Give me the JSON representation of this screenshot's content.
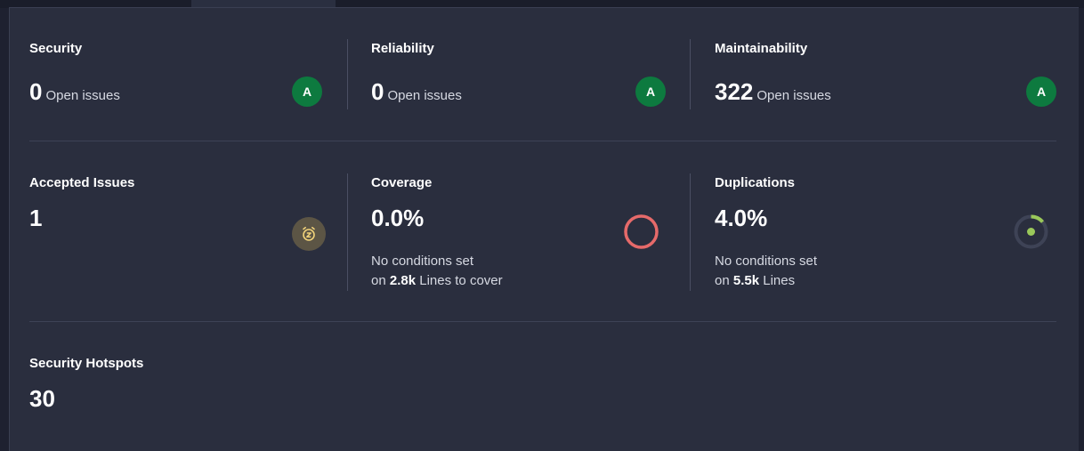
{
  "colors": {
    "grade_a": "#0d7a3f",
    "coverage_ring": "#e66a6a",
    "duplication_ring": "#9ac85a",
    "accepted_icon": "#f0d27a"
  },
  "security": {
    "title": "Security",
    "value": "0",
    "unit": "Open issues",
    "grade": "A"
  },
  "reliability": {
    "title": "Reliability",
    "value": "0",
    "unit": "Open issues",
    "grade": "A"
  },
  "maintainability": {
    "title": "Maintainability",
    "value": "322",
    "unit": "Open issues",
    "grade": "A"
  },
  "accepted": {
    "title": "Accepted Issues",
    "value": "1",
    "icon": "snooze-clock-icon"
  },
  "coverage": {
    "title": "Coverage",
    "value": "0.0%",
    "line1": "No conditions set",
    "line2_prefix": "on",
    "line2_bold": "2.8k",
    "line2_suffix": "Lines to cover",
    "percent": 0.0
  },
  "duplications": {
    "title": "Duplications",
    "value": "4.0%",
    "line1": "No conditions set",
    "line2_prefix": "on",
    "line2_bold": "5.5k",
    "line2_suffix": "Lines",
    "percent": 4.0
  },
  "hotspots": {
    "title": "Security Hotspots",
    "value": "30"
  }
}
